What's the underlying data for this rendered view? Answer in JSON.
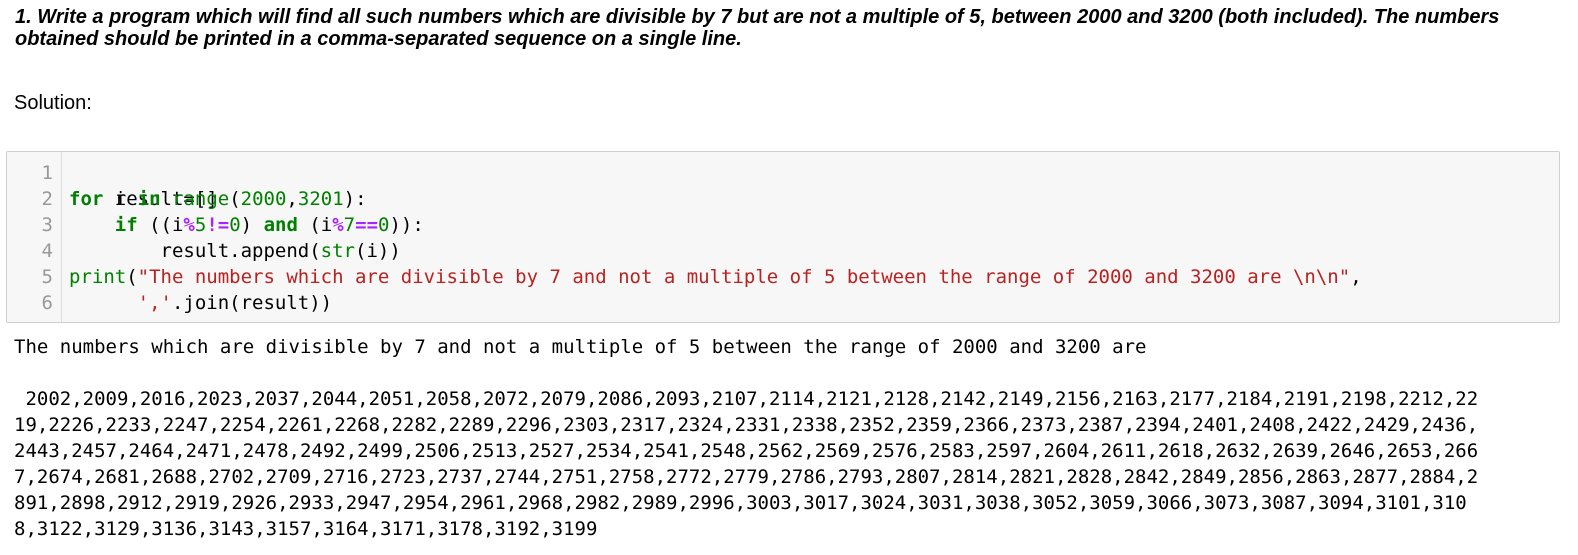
{
  "question": "1. Write a program which will find all such numbers which are divisible by 7 but are not a multiple of 5, between 2000 and 3200 (both included). The numbers obtained should be printed in a comma-separated sequence on a single line.",
  "solution_label": "Solution:",
  "code": {
    "line_numbers": [
      "1",
      "2",
      "3",
      "4",
      "5",
      "6"
    ],
    "line1": {
      "text": "result=[]"
    },
    "line2": {
      "for": "for",
      "var": " i ",
      "in": "in",
      "range": "range",
      "open": "(",
      "a": "2000",
      "comma": ",",
      "b": "3201",
      "close": "):"
    },
    "line3": {
      "indent": "    ",
      "if": "if",
      "p1": " ((i",
      "mod1": "%",
      "n5": "5",
      "ne": "!=",
      "z1": "0",
      "p2": ") ",
      "and": "and",
      "p3": " (i",
      "mod2": "%",
      "n7": "7",
      "eq": "==",
      "z2": "0",
      "p4": ")):"
    },
    "line4": {
      "indent": "        result.append(",
      "str": "str",
      "rest": "(i))"
    },
    "line5": {
      "print": "print",
      "open": "(",
      "string": "\"The numbers which are divisible by 7 and not a multiple of 5 between the range of 2000 and 3200 are \\n\\n\"",
      "tail": ","
    },
    "line6": {
      "indent": "      ",
      "sep": "','",
      "join": ".join(result))"
    }
  },
  "output": {
    "header": "The numbers which are divisible by 7 and not a multiple of 5 between the range of 2000 and 3200 are",
    "lines": [
      " 2002,2009,2016,2023,2037,2044,2051,2058,2072,2079,2086,2093,2107,2114,2121,2128,2142,2149,2156,2163,2177,2184,2191,2198,2212,22",
      "19,2226,2233,2247,2254,2261,2268,2282,2289,2296,2303,2317,2324,2331,2338,2352,2359,2366,2373,2387,2394,2401,2408,2422,2429,2436,",
      "2443,2457,2464,2471,2478,2492,2499,2506,2513,2527,2534,2541,2548,2562,2569,2576,2583,2597,2604,2611,2618,2632,2639,2646,2653,266",
      "7,2674,2681,2688,2702,2709,2716,2723,2737,2744,2751,2758,2772,2779,2786,2793,2807,2814,2821,2828,2842,2849,2856,2863,2877,2884,2",
      "891,2898,2912,2919,2926,2933,2947,2954,2961,2968,2982,2989,2996,3003,3017,3024,3031,3038,3052,3059,3066,3073,3087,3094,3101,310",
      "8,3122,3129,3136,3143,3157,3164,3171,3178,3192,3199"
    ]
  }
}
